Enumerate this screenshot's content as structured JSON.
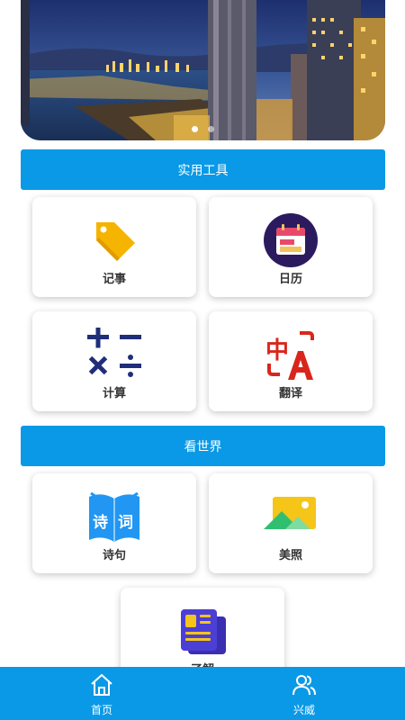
{
  "banner": {
    "image": "city-harbor-night-skyline",
    "slides": 2,
    "active_slide": 1
  },
  "sections": [
    {
      "title": "实用工具",
      "items": [
        {
          "label": "记事",
          "icon": "tag-icon"
        },
        {
          "label": "日历",
          "icon": "calendar-icon"
        },
        {
          "label": "计算",
          "icon": "calculator-icon"
        },
        {
          "label": "翻译",
          "icon": "translate-icon"
        }
      ]
    },
    {
      "title": "看世界",
      "items": [
        {
          "label": "诗句",
          "icon": "poetry-book-icon"
        },
        {
          "label": "美照",
          "icon": "photo-icon"
        },
        {
          "label": "了解",
          "icon": "news-icon"
        }
      ]
    }
  ],
  "icon_texts": {
    "poetry_left": "诗",
    "poetry_right": "词",
    "translate_zh": "中"
  },
  "tabbar": [
    {
      "label": "首页",
      "icon": "home-icon"
    },
    {
      "label": "兴威",
      "icon": "users-icon"
    }
  ],
  "colors": {
    "accent": "#0a99e6",
    "card_bg": "#ffffff",
    "text": "#333333"
  }
}
